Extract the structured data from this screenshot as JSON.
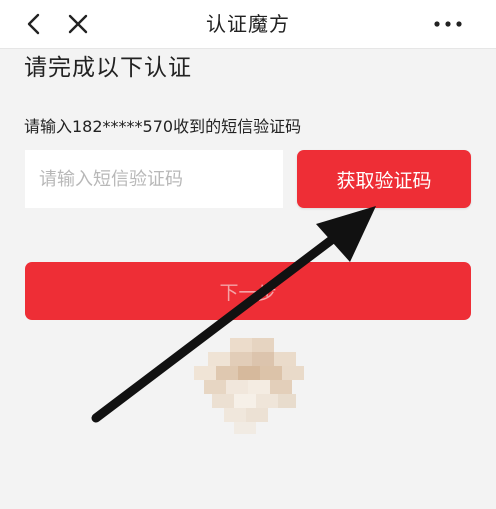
{
  "navbar": {
    "title": "认证魔方",
    "back_icon": "chevron-left-icon",
    "close_icon": "close-icon",
    "more_icon": "more-dots-icon"
  },
  "content": {
    "heading": "请完成以下认证",
    "instruction": "请输入182*****570收到的短信验证码",
    "code_input": {
      "value": "",
      "placeholder": "请输入短信验证码"
    },
    "get_code_label": "获取验证码",
    "next_label": "下一步"
  },
  "colors": {
    "accent": "#ee2e36",
    "background": "#f3f3f3",
    "text": "#222222",
    "placeholder": "#b8b8b8",
    "next_label": "#f4a3a6",
    "annotation_arrow": "#111111"
  }
}
